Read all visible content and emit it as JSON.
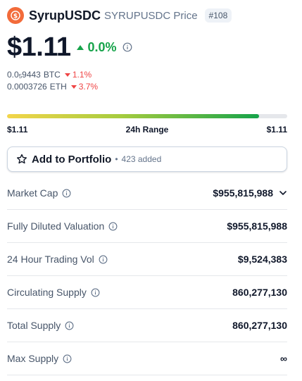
{
  "header": {
    "name": "SyrupUSDC",
    "price_label": "SYRUPUSDC Price",
    "rank": "#108"
  },
  "price": {
    "value": "$1.11",
    "change": "0.0%"
  },
  "conversions": [
    {
      "prefix": "0.0",
      "sub": "5",
      "digits": "9443",
      "unit": "BTC",
      "change": "1.1%"
    },
    {
      "value": "0.0003726",
      "unit": "ETH",
      "change": "3.7%"
    }
  ],
  "range": {
    "low": "$1.11",
    "label": "24h Range",
    "high": "$1.11",
    "position_fraction": 0.9
  },
  "portfolio": {
    "label": "Add to Portfolio",
    "added": "423 added"
  },
  "stats": [
    {
      "label": "Market Cap",
      "value": "$955,815,988"
    },
    {
      "label": "Fully Diluted Valuation",
      "value": "$955,815,988"
    },
    {
      "label": "24 Hour Trading Vol",
      "value": "$9,524,383"
    },
    {
      "label": "Circulating Supply",
      "value": "860,277,130"
    },
    {
      "label": "Total Supply",
      "value": "860,277,130"
    },
    {
      "label": "Max Supply",
      "value": "∞"
    }
  ],
  "colors": {
    "logo": "#f26b3a",
    "up": "#16a34a",
    "down": "#ef4444"
  }
}
